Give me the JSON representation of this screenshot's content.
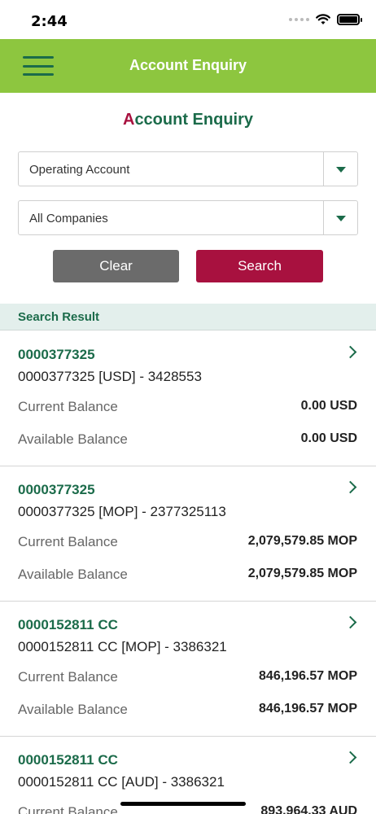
{
  "status_bar": {
    "time": "2:44"
  },
  "header": {
    "title": "Account Enquiry"
  },
  "page": {
    "title_first": "A",
    "title_rest": "ccount Enquiry"
  },
  "filters": {
    "account_type": "Operating Account",
    "company": "All Companies"
  },
  "buttons": {
    "clear": "Clear",
    "search": "Search"
  },
  "results": {
    "heading": "Search Result",
    "current_label": "Current Balance",
    "available_label": "Available Balance",
    "items": [
      {
        "id": "0000377325",
        "desc": "0000377325 [USD] - 3428553",
        "current": "0.00 USD",
        "available": "0.00 USD"
      },
      {
        "id": "0000377325",
        "desc": "0000377325 [MOP] - 2377325113",
        "current": "2,079,579.85 MOP",
        "available": "2,079,579.85 MOP"
      },
      {
        "id": "0000152811 CC",
        "desc": "0000152811 CC [MOP] - 3386321",
        "current": "846,196.57 MOP",
        "available": "846,196.57 MOP"
      },
      {
        "id": "0000152811 CC",
        "desc": "0000152811 CC [AUD] - 3386321",
        "current": "893,964.33 AUD",
        "available": ""
      }
    ]
  },
  "colors": {
    "header_green": "#8dc63f",
    "brand_green": "#1b6b4a",
    "accent_red": "#a8113f",
    "clear_gray": "#6b6b6b"
  }
}
